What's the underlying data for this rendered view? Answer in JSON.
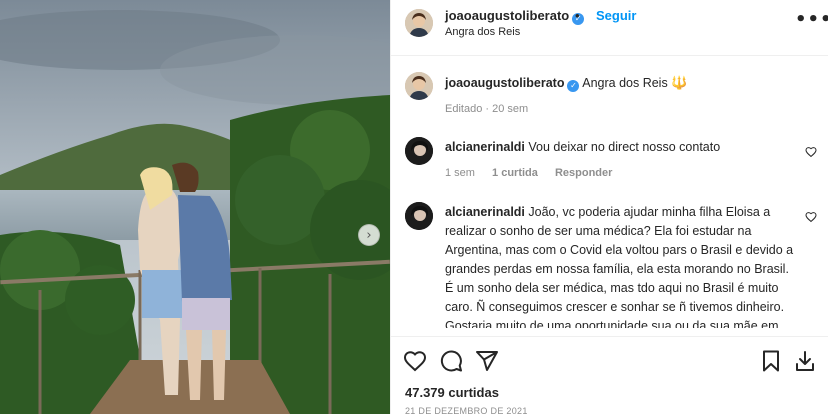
{
  "post": {
    "username": "joaoaugustoliberato",
    "follow_label": "Seguir",
    "location": "Angra dos Reis",
    "carousel_next": "›",
    "more_label": "•••"
  },
  "caption": {
    "username": "joaoaugustoliberato",
    "text": "Angra dos Reis",
    "emoji": "🔱",
    "meta": "Editado · 20 sem"
  },
  "comments": [
    {
      "username": "alcianerinaldi",
      "text": "Vou deixar no direct nosso contato",
      "time": "1 sem",
      "likes": "1 curtida",
      "reply_label": "Responder"
    },
    {
      "username": "alcianerinaldi",
      "text": "João, vc poderia ajudar minha filha Eloisa a realizar o sonho de ser uma médica? Ela foi estudar na Argentina, mas com o Covid ela voltou pars o Brasil e devido a grandes perdas em nossa família, ela esta morando no Brasil. É um sonho dela ser médica, mas tdo aqui no Brasil é muito caro. Ñ conseguimos crescer e sonhar se ñ tivemos dinheiro. Gostaria muito de uma oportunidade sua ou da sua mãe em nos ajudar a proceguir com este sonho. Este é meu humilde pedido. Obrigada Alcione Rinaldi"
    }
  ],
  "footer": {
    "likes": "47.379 curtidas",
    "date": "21 DE DEZEMBRO DE 2021"
  },
  "colors": {
    "accent": "#0095f6",
    "verified": "#3897f0",
    "muted": "#8e8e8e"
  },
  "icons": [
    "heart-icon",
    "comment-icon",
    "share-icon",
    "bookmark-icon",
    "download-icon",
    "verified-icon",
    "more-icon"
  ]
}
